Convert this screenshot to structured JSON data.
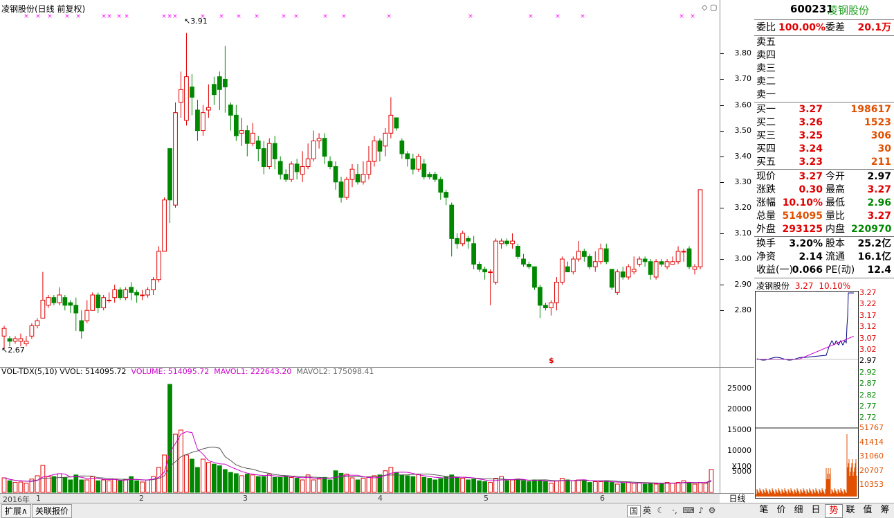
{
  "window": {
    "title": "凌钢股份(日线 前复权)",
    "period_tab": "日线"
  },
  "main_chart": {
    "annotation_high": "3.91",
    "annotation_low": "2.67",
    "marker_s": "$",
    "marker_color": "#ff00ff"
  },
  "volume_header": {
    "name": "VOL-TDX(5,10)",
    "vol": "VVOL: 514095.72",
    "volume": "VOLUME: 514095.72",
    "mavol1": "MAVOL1: 222643.20",
    "mavol2": "MAVOL2: 175098.41"
  },
  "date_labels": [
    "2016年",
    "1",
    "2",
    "3",
    "4",
    "5",
    "6"
  ],
  "price_axis_labels": [
    "3.80",
    "3.70",
    "3.60",
    "3.50",
    "3.40",
    "3.30",
    "3.20",
    "3.10",
    "3.00",
    "2.90",
    "2.80"
  ],
  "vol_axis_labels": [
    "25000",
    "20000",
    "15000",
    "10000",
    "5000",
    "X100"
  ],
  "bottom_tabs": {
    "expand": "扩展∧",
    "related": "关联报价"
  },
  "toolbar_icons": [
    "国",
    "英",
    "moon-icon",
    "keyboard-icon",
    "speaker-icon",
    "settings-icon",
    "gear-icon",
    "wrench-icon"
  ],
  "quote": {
    "code": "600231",
    "name": "凌钢股份",
    "weibi_label": "委比",
    "weibi": "100.00%",
    "weicha_label": "委差",
    "weicha": "20.1万",
    "sell": [
      "卖五",
      "卖四",
      "卖三",
      "卖二",
      "卖一"
    ],
    "buy": [
      {
        "label": "买一",
        "price": "3.27",
        "vol": "198617"
      },
      {
        "label": "买二",
        "price": "3.26",
        "vol": "1523"
      },
      {
        "label": "买三",
        "price": "3.25",
        "vol": "306"
      },
      {
        "label": "买四",
        "price": "3.24",
        "vol": "30"
      },
      {
        "label": "买五",
        "price": "3.23",
        "vol": "211"
      }
    ],
    "stats": [
      {
        "k1": "现价",
        "v1": "3.27",
        "k2": "今开",
        "v2": "2.97"
      },
      {
        "k1": "涨跌",
        "v1": "0.30",
        "k2": "最高",
        "v2": "3.27"
      },
      {
        "k1": "涨幅",
        "v1": "10.10%",
        "k2": "最低",
        "v2": "2.96"
      },
      {
        "k1": "总量",
        "v1": "514095",
        "k2": "量比",
        "v2": "3.27"
      },
      {
        "k1": "外盘",
        "v1": "293125",
        "k2": "内盘",
        "v2": "220970"
      }
    ],
    "stats2": [
      {
        "k1": "换手",
        "v1": "3.20%",
        "k2": "股本",
        "v2": "25.2亿"
      },
      {
        "k1": "净资",
        "v1": "2.14",
        "k2": "流通",
        "v2": "16.1亿"
      },
      {
        "k1": "收益(一)",
        "v1": "0.066",
        "k2": "PE(动)",
        "v2": "12.4"
      }
    ]
  },
  "spark": {
    "title_name": "凌钢股份",
    "title_price": "3.27",
    "title_pct": "10.10%",
    "price_labels": [
      "3.27",
      "3.22",
      "3.17",
      "3.12",
      "3.07",
      "3.02",
      "2.97",
      "2.92",
      "2.87",
      "2.82",
      "2.77",
      "2.72"
    ],
    "vol_labels": [
      "51767",
      "41414",
      "31060",
      "20707",
      "10353"
    ]
  },
  "right_tabs": [
    "笔",
    "价",
    "细",
    "日",
    "势",
    "联",
    "值",
    "筹"
  ],
  "chart_data": {
    "type": "candlestick",
    "ohlc": [
      [
        2.7,
        2.73,
        2.65,
        2.74
      ],
      [
        2.69,
        2.68,
        2.66,
        2.7
      ],
      [
        2.68,
        2.69,
        2.67,
        2.7
      ],
      [
        2.68,
        2.69,
        2.66,
        2.71
      ],
      [
        2.67,
        2.68,
        2.66,
        2.7
      ],
      [
        2.7,
        2.74,
        2.69,
        2.75
      ],
      [
        2.74,
        2.76,
        2.73,
        2.77
      ],
      [
        2.77,
        2.84,
        2.77,
        2.95
      ],
      [
        2.82,
        2.85,
        2.81,
        2.86
      ],
      [
        2.85,
        2.83,
        2.82,
        2.86
      ],
      [
        2.83,
        2.86,
        2.82,
        2.89
      ],
      [
        2.85,
        2.82,
        2.8,
        2.86
      ],
      [
        2.83,
        2.82,
        2.79,
        2.84
      ],
      [
        2.82,
        2.79,
        2.72,
        2.85
      ],
      [
        2.76,
        2.72,
        2.69,
        2.8
      ],
      [
        2.76,
        2.8,
        2.75,
        2.84
      ],
      [
        2.8,
        2.86,
        2.8,
        2.87
      ],
      [
        2.86,
        2.81,
        2.79,
        2.87
      ],
      [
        2.81,
        2.85,
        2.8,
        2.86
      ],
      [
        2.84,
        2.84,
        2.83,
        2.87
      ],
      [
        2.85,
        2.88,
        2.83,
        2.9
      ],
      [
        2.88,
        2.85,
        2.84,
        2.89
      ],
      [
        2.85,
        2.88,
        2.84,
        2.89
      ],
      [
        2.89,
        2.87,
        2.84,
        2.91
      ],
      [
        2.87,
        2.86,
        2.83,
        2.88
      ],
      [
        2.86,
        2.86,
        2.84,
        2.88
      ],
      [
        2.86,
        2.88,
        2.85,
        2.89
      ],
      [
        2.88,
        2.92,
        2.86,
        2.93
      ],
      [
        2.92,
        3.03,
        2.91,
        3.05
      ],
      [
        3.03,
        3.23,
        3.03,
        3.24
      ],
      [
        3.43,
        3.23,
        3.14,
        3.43
      ],
      [
        3.21,
        3.57,
        3.2,
        3.61
      ],
      [
        3.61,
        3.66,
        3.55,
        3.73
      ],
      [
        3.54,
        3.71,
        3.52,
        3.88
      ],
      [
        3.67,
        3.63,
        3.56,
        3.72
      ],
      [
        3.58,
        3.5,
        3.46,
        3.62
      ],
      [
        3.5,
        3.57,
        3.48,
        3.6
      ],
      [
        3.58,
        3.59,
        3.55,
        3.68
      ],
      [
        3.68,
        3.64,
        3.6,
        3.71
      ],
      [
        3.71,
        3.66,
        3.58,
        3.73
      ],
      [
        3.7,
        3.67,
        3.57,
        3.83
      ],
      [
        3.6,
        3.56,
        3.5,
        3.61
      ],
      [
        3.56,
        3.48,
        3.46,
        3.6
      ],
      [
        3.49,
        3.5,
        3.44,
        3.55
      ],
      [
        3.5,
        3.45,
        3.4,
        3.52
      ],
      [
        3.45,
        3.49,
        3.44,
        3.53
      ],
      [
        3.46,
        3.43,
        3.38,
        3.48
      ],
      [
        3.43,
        3.36,
        3.33,
        3.46
      ],
      [
        3.36,
        3.45,
        3.35,
        3.47
      ],
      [
        3.45,
        3.39,
        3.35,
        3.48
      ],
      [
        3.38,
        3.33,
        3.31,
        3.4
      ],
      [
        3.33,
        3.31,
        3.3,
        3.35
      ],
      [
        3.31,
        3.37,
        3.3,
        3.38
      ],
      [
        3.37,
        3.34,
        3.31,
        3.39
      ],
      [
        3.33,
        3.36,
        3.3,
        3.42
      ],
      [
        3.36,
        3.39,
        3.35,
        3.45
      ],
      [
        3.39,
        3.46,
        3.38,
        3.5
      ],
      [
        3.46,
        3.47,
        3.43,
        3.49
      ],
      [
        3.47,
        3.4,
        3.37,
        3.49
      ],
      [
        3.38,
        3.36,
        3.35,
        3.4
      ],
      [
        3.36,
        3.3,
        3.27,
        3.38
      ],
      [
        3.3,
        3.24,
        3.22,
        3.32
      ],
      [
        3.24,
        3.31,
        3.23,
        3.32
      ],
      [
        3.31,
        3.35,
        3.28,
        3.37
      ],
      [
        3.33,
        3.3,
        3.29,
        3.37
      ],
      [
        3.3,
        3.33,
        3.29,
        3.38
      ],
      [
        3.33,
        3.38,
        3.31,
        3.44
      ],
      [
        3.38,
        3.46,
        3.36,
        3.48
      ],
      [
        3.46,
        3.42,
        3.38,
        3.47
      ],
      [
        3.44,
        3.49,
        3.4,
        3.51
      ],
      [
        3.49,
        3.56,
        3.47,
        3.63
      ],
      [
        3.55,
        3.51,
        3.5,
        3.55
      ],
      [
        3.46,
        3.41,
        3.39,
        3.47
      ],
      [
        3.41,
        3.39,
        3.36,
        3.42
      ],
      [
        3.39,
        3.35,
        3.33,
        3.41
      ],
      [
        3.35,
        3.4,
        3.34,
        3.41
      ],
      [
        3.37,
        3.32,
        3.31,
        3.39
      ],
      [
        3.33,
        3.32,
        3.31,
        3.34
      ],
      [
        3.33,
        3.31,
        3.3,
        3.34
      ],
      [
        3.31,
        3.26,
        3.23,
        3.32
      ],
      [
        3.26,
        3.24,
        3.21,
        3.27
      ],
      [
        3.21,
        3.08,
        3.01,
        3.22
      ],
      [
        3.08,
        3.06,
        3.04,
        3.1
      ],
      [
        3.06,
        3.1,
        3.05,
        3.11
      ],
      [
        3.08,
        3.07,
        3.04,
        3.09
      ],
      [
        3.06,
        2.98,
        2.96,
        3.09
      ],
      [
        2.98,
        2.96,
        2.95,
        2.99
      ],
      [
        2.96,
        2.95,
        2.92,
        2.97
      ],
      [
        2.95,
        2.95,
        2.82,
        2.96
      ],
      [
        2.91,
        3.07,
        2.9,
        3.08
      ],
      [
        3.06,
        3.07,
        3.04,
        3.08
      ],
      [
        3.07,
        3.06,
        3.05,
        3.08
      ],
      [
        3.06,
        3.07,
        3.04,
        3.1
      ],
      [
        3.05,
        3.01,
        3.0,
        3.06
      ],
      [
        3.0,
        2.98,
        2.97,
        3.02
      ],
      [
        2.98,
        2.97,
        2.96,
        2.99
      ],
      [
        2.97,
        2.89,
        2.88,
        2.97
      ],
      [
        2.89,
        2.82,
        2.77,
        2.9
      ],
      [
        2.82,
        2.81,
        2.8,
        2.83
      ],
      [
        2.81,
        2.83,
        2.78,
        2.84
      ],
      [
        2.83,
        2.91,
        2.8,
        2.93
      ],
      [
        2.91,
        3.0,
        2.9,
        3.01
      ],
      [
        2.97,
        2.95,
        2.95,
        2.99
      ],
      [
        2.95,
        3.0,
        2.94,
        3.01
      ],
      [
        3.0,
        3.03,
        2.99,
        3.07
      ],
      [
        3.03,
        3.01,
        2.99,
        3.04
      ],
      [
        3.01,
        2.97,
        2.96,
        3.02
      ],
      [
        2.97,
        2.99,
        2.95,
        3.03
      ],
      [
        2.99,
        3.04,
        2.98,
        3.06
      ],
      [
        3.04,
        2.99,
        2.98,
        3.06
      ],
      [
        2.96,
        2.89,
        2.88,
        2.96
      ],
      [
        2.87,
        2.95,
        2.86,
        2.96
      ],
      [
        2.95,
        2.93,
        2.92,
        2.97
      ],
      [
        2.93,
        2.97,
        2.92,
        2.98
      ],
      [
        2.95,
        2.96,
        2.94,
        3.01
      ],
      [
        2.98,
        3.0,
        2.97,
        3.01
      ],
      [
        3.0,
        2.99,
        2.97,
        3.01
      ],
      [
        2.99,
        2.94,
        2.92,
        3.0
      ],
      [
        2.93,
        2.99,
        2.92,
        3.0
      ],
      [
        2.99,
        2.98,
        2.97,
        3.0
      ],
      [
        2.97,
        2.99,
        2.96,
        3.0
      ],
      [
        2.98,
        2.99,
        2.98,
        3.01
      ],
      [
        2.99,
        3.03,
        2.98,
        3.05
      ],
      [
        3.03,
        3.03,
        2.99,
        3.04
      ],
      [
        3.04,
        2.97,
        2.96,
        3.05
      ],
      [
        2.96,
        2.97,
        2.94,
        2.98
      ],
      [
        2.97,
        3.27,
        2.96,
        3.27
      ]
    ],
    "volume": [
      35,
      28,
      24,
      25,
      22,
      32,
      40,
      65,
      38,
      38,
      45,
      35,
      30,
      42,
      30,
      30,
      38,
      28,
      30,
      28,
      32,
      28,
      30,
      38,
      28,
      25,
      30,
      38,
      60,
      90,
      260,
      140,
      150,
      90,
      80,
      60,
      80,
      72,
      68,
      64,
      55,
      48,
      45,
      40,
      44,
      42,
      38,
      38,
      44,
      36,
      36,
      40,
      36,
      34,
      30,
      42,
      30,
      32,
      36,
      30,
      52,
      46,
      44,
      35,
      30,
      34,
      36,
      40,
      42,
      52,
      60,
      48,
      42,
      40,
      38,
      44,
      36,
      34,
      30,
      33,
      38,
      42,
      36,
      34,
      30,
      32,
      28,
      26,
      24,
      34,
      38,
      28,
      30,
      32,
      28,
      26,
      30,
      30,
      26,
      22,
      28,
      34,
      30,
      28,
      30,
      30,
      24,
      26,
      26,
      28,
      24,
      20,
      22,
      24,
      22,
      24,
      20,
      22,
      20,
      22,
      24,
      22,
      24,
      28,
      24,
      20,
      24,
      22,
      55
    ],
    "price_range": [
      2.62,
      3.96
    ],
    "volume_range": [
      0,
      28000
    ]
  }
}
